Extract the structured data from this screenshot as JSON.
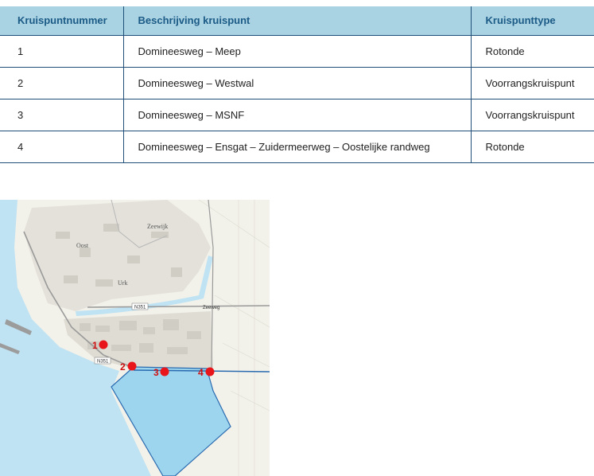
{
  "table": {
    "headers": [
      "Kruispuntnummer",
      "Beschrijving kruispunt",
      "Kruispunttype"
    ],
    "rows": [
      {
        "nummer": "1",
        "beschrijving": "Domineesweg – Meep",
        "type": "Rotonde"
      },
      {
        "nummer": "2",
        "beschrijving": "Domineesweg – Westwal",
        "type": "Voorrangskruispunt"
      },
      {
        "nummer": "3",
        "beschrijving": "Domineesweg – MSNF",
        "type": "Voorrangskruispunt"
      },
      {
        "nummer": "4",
        "beschrijving": "Domineesweg – Ensgat – Zuidermeerweg – Oostelijke randweg",
        "type": "Rotonde"
      }
    ]
  },
  "map": {
    "markers": [
      {
        "label": "1"
      },
      {
        "label": "2"
      },
      {
        "label": "3"
      },
      {
        "label": "4"
      }
    ],
    "places": {
      "urk": "Urk",
      "zeewijk": "Zeewijk",
      "oost": "Oost",
      "zeeweg": "Zeeweg"
    },
    "roads": {
      "n351_a": "N351",
      "n351_b": "N351"
    },
    "colors": {
      "marker": "#e8161b",
      "water": "#bfe3f3",
      "area": "#8fd0ef",
      "land": "#f2f1ea",
      "built": "#e0ded6"
    }
  }
}
